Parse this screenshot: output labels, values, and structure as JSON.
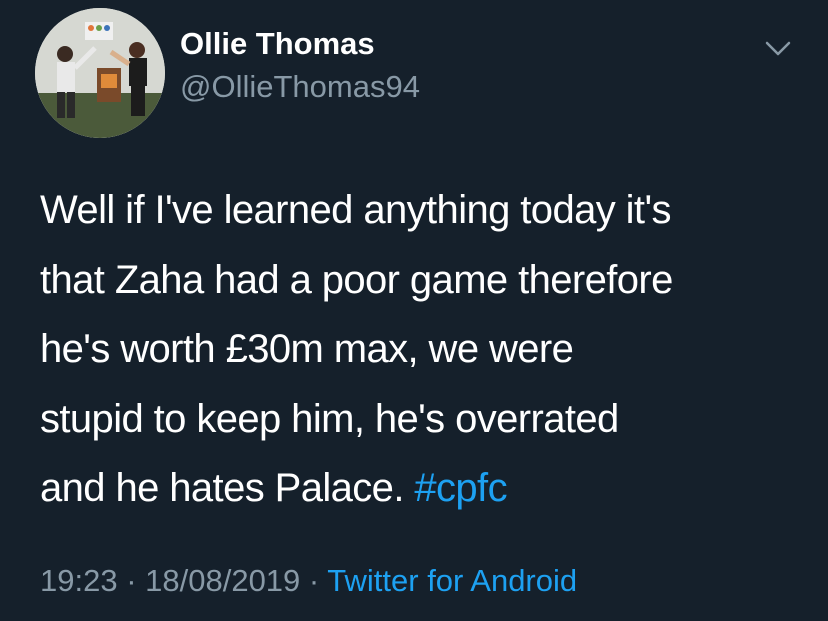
{
  "tweet": {
    "author": {
      "display_name": "Ollie Thomas",
      "handle": "@OllieThomas94"
    },
    "menu_icon": "chevron-down-icon",
    "text_lines": [
      "Well if I've learned anything today it's",
      "that Zaha had a poor game therefore",
      "he's worth £30m max, we were",
      "stupid to keep him, he's overrated"
    ],
    "last_line_text": "and he hates Palace. ",
    "hashtag": "#cpfc",
    "time": "19:23",
    "separator": " · ",
    "date": "18/08/2019",
    "source": "Twitter for Android"
  },
  "colors": {
    "background": "#15202b",
    "primary_text": "#ffffff",
    "secondary_text": "#8899a6",
    "accent": "#1da1f2"
  }
}
